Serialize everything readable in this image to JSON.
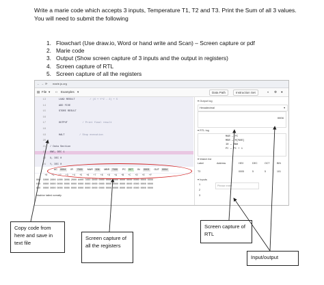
{
  "intro": {
    "line1": "Write a marie code which accepts 3 inputs, Temperature T1, T2 and T3. Print the Sum of all 3 values.",
    "line2": "You will need to submit the following"
  },
  "steps": [
    {
      "num": "1.",
      "text": "Flowchart (Use draw.io, Word or hand write and Scan) – Screen capture or pdf"
    },
    {
      "num": "2.",
      "text": "Marie code"
    },
    {
      "num": "3.",
      "text": "Output (Show screen capture of 3 inputs and the output in registers)"
    },
    {
      "num": "4.",
      "text": "Screen capture of RTL"
    },
    {
      "num": "5.",
      "text": "Screen capture of all the registers"
    }
  ],
  "screenshot": {
    "url": "marie.js.org",
    "file_menu": "File",
    "examples_menu": "Examples",
    "data_path_button": "Data Path",
    "instruction_set_button": "Instruction Set",
    "code_lines": [
      {
        "ln": "13",
        "text": "      LOAD RESULT",
        "comment": "/ (X + Y*Z - 2) + 5",
        "hl": false
      },
      {
        "ln": "14",
        "text": "      ADD FIVE",
        "comment": "",
        "hl": false
      },
      {
        "ln": "15",
        "text": "      STORE RESULT",
        "comment": "",
        "hl": false
      },
      {
        "ln": "16",
        "text": "",
        "comment": "",
        "hl": false
      },
      {
        "ln": "17",
        "text": "      OUTPUT",
        "comment": "/ Print final result",
        "hl": false
      },
      {
        "ln": "18",
        "text": "",
        "comment": "",
        "hl": false
      },
      {
        "ln": "19",
        "text": "      HALT",
        "comment": "/ Stop execution",
        "hl": false
      },
      {
        "ln": "20",
        "text": "",
        "comment": "",
        "hl": false
      },
      {
        "ln": "21",
        "text": "/ Data Section",
        "comment": "",
        "hl": false
      },
      {
        "ln": "22",
        "text": "ONE, DEC 1",
        "comment": "",
        "hl": true
      },
      {
        "ln": "23",
        "text": "X, DEC 0",
        "comment": "",
        "hl": false
      },
      {
        "ln": "24",
        "text": "Y, DEC 0",
        "comment": "",
        "hl": false
      },
      {
        "ln": "25",
        "text": "Z, DEC 0",
        "comment": "",
        "hl": false
      },
      {
        "ln": "26",
        "text": "",
        "comment": "",
        "hl": false
      }
    ],
    "registers": [
      {
        "name": "AC",
        "value": "0004"
      },
      {
        "name": "IR",
        "value": "7000"
      },
      {
        "name": "MAR",
        "value": "006"
      },
      {
        "name": "MBR",
        "value": "7000"
      },
      {
        "name": "PC",
        "value": "007"
      },
      {
        "name": "IN",
        "value": "0003"
      },
      {
        "name": "OUT",
        "value": "0004"
      }
    ],
    "memory_header": [
      "+0",
      "+1",
      "+2",
      "+3",
      "+4",
      "+5",
      "+6",
      "+7",
      "+8",
      "+9",
      "+A",
      "+B",
      "+C",
      "+D",
      "+E",
      "+F"
    ],
    "memory_rows": [
      {
        "addr": "000",
        "cells": "5000 2000 1000 3006 2000 6000 7000 0000 0000 0000 0000 0000 0000 0000 0000 0000"
      },
      {
        "addr": "010",
        "cells": "0000 0000 0000 0000 0000 0000 0000 0000 0000 0000 0000 0000 0000 0000 0000 0000"
      },
      {
        "addr": "020",
        "cells": "0000 0000 0000 0000 0000 0000 0000 0000 0000 0000 0000 0000 0000 0000 0000 0000"
      }
    ],
    "status_text": "Machine halted normally.",
    "output_log_label": "Output log",
    "output_format": "Hexadecimal",
    "output_value": "0006",
    "rtl_label": "RTL log",
    "rtl_lines": [
      "MAR ← PC",
      "MBR ← M[MAR]",
      "IR ← MBR",
      "PC ← PC + 1"
    ],
    "watch_label": "Watch list",
    "watch_headers": [
      "Label",
      "Address",
      "HEX",
      "DEC",
      "OCT",
      "BIN"
    ],
    "watch_row": [
      "T3",
      "",
      "0005",
      "5",
      "5",
      "101"
    ],
    "inputs_label": "Inputs",
    "inputs_placeholder": "Please enter",
    "inputs_values": [
      "1",
      "2",
      "3"
    ]
  },
  "callouts": {
    "copy_code": "Copy code from here and save in text file",
    "registers": "Screen capture of all the registers",
    "rtl": "Screen capture of RTL",
    "io": "Input/output"
  }
}
